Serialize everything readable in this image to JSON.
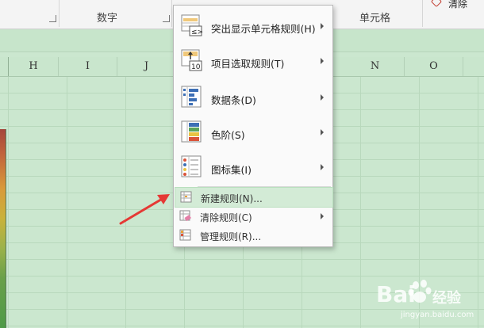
{
  "ribbon": {
    "group_number": "数字",
    "group_cell": "单元格",
    "clear_label": "清除"
  },
  "columns": [
    "H",
    "I",
    "J",
    "N",
    "O"
  ],
  "menu": {
    "items": [
      {
        "label": "突出显示单元格规则(H)",
        "has_submenu": true,
        "icon": "highlight-cells-rules-icon"
      },
      {
        "label": "项目选取规则(T)",
        "has_submenu": true,
        "icon": "top-bottom-rules-icon"
      },
      {
        "label": "数据条(D)",
        "has_submenu": true,
        "icon": "data-bars-icon"
      },
      {
        "label": "色阶(S)",
        "has_submenu": true,
        "icon": "color-scales-icon"
      },
      {
        "label": "图标集(I)",
        "has_submenu": true,
        "icon": "icon-sets-icon"
      },
      {
        "label": "新建规则(N)...",
        "has_submenu": false,
        "icon": "new-rule-icon"
      },
      {
        "label": "清除规则(C)",
        "has_submenu": true,
        "icon": "clear-rules-icon"
      },
      {
        "label": "管理规则(R)...",
        "has_submenu": false,
        "icon": "manage-rules-icon"
      }
    ]
  },
  "watermark": {
    "brand": "Bai",
    "brand_cn": "经验",
    "url": "jingyan.baidu.com"
  },
  "colors": {
    "sheet_background": "#cbe7cf",
    "menu_hover": "#d3ebd6",
    "arrow_red": "#e53935"
  }
}
